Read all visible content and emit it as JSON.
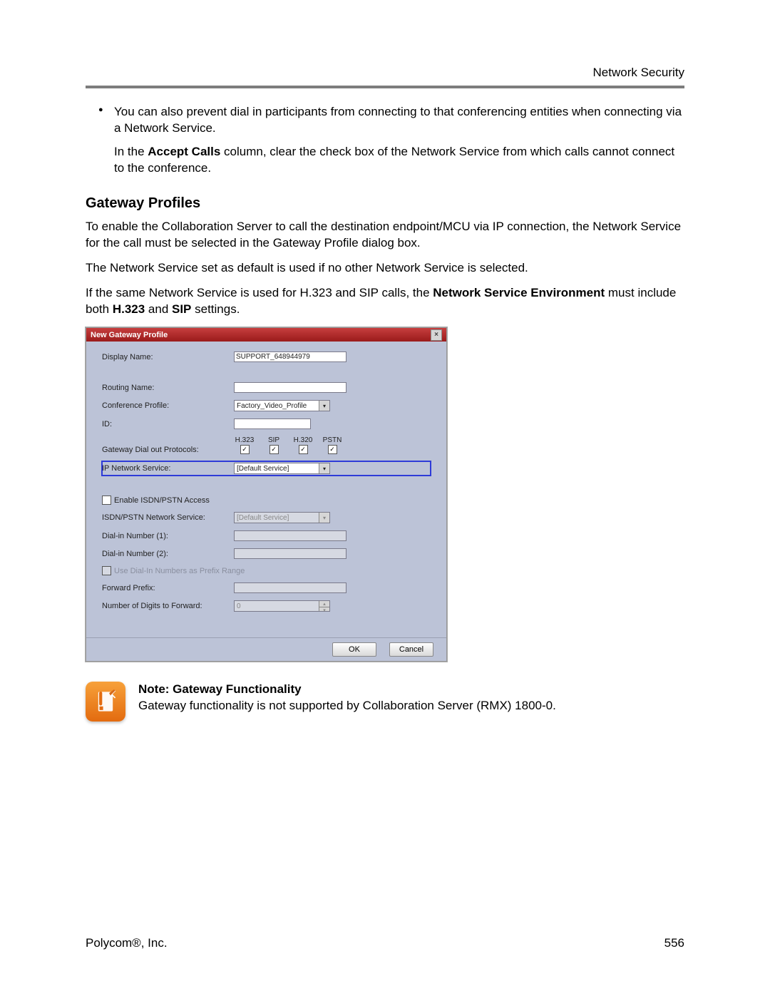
{
  "page_header_right": "Network Security",
  "bullets": {
    "li1": "You can also prevent dial in participants from connecting to that conferencing entities when connecting via a Network Service.",
    "li1b_prefix": "In the ",
    "li1b_bold": "Accept Calls",
    "li1b_suffix": " column, clear the check box of the Network Service from which calls cannot connect to the conference."
  },
  "heading_gateway": "Gateway Profiles",
  "p1": "To enable the Collaboration Server to call the destination endpoint/MCU via IP connection, the Network Service for the call must be selected in the Gateway Profile dialog box.",
  "p2": "The Network Service set as default is used if no other Network Service is selected.",
  "p3a": "If the same Network Service is used for H.323 and SIP calls, the ",
  "p3b_bold": "Network Service Environment",
  "p3c": " must include both ",
  "p3d_bold": "H.323",
  "p3e": " and ",
  "p3f_bold": "SIP",
  "p3g": " settings.",
  "dialog": {
    "title": "New Gateway Profile",
    "close": "×",
    "fields": {
      "display_name_lbl": "Display Name:",
      "display_name_val": "SUPPORT_648944979",
      "routing_name_lbl": "Routing Name:",
      "routing_name_val": "",
      "conf_profile_lbl": "Conference Profile:",
      "conf_profile_val": "Factory_Video_Profile",
      "id_lbl": "ID:",
      "id_val": "",
      "gw_proto_lbl": "Gateway Dial out Protocols:",
      "proto_cols": {
        "c1": "H.323",
        "c2": "SIP",
        "c3": "H.320",
        "c4": "PSTN"
      },
      "proto_check": "✓",
      "ip_ns_lbl": "IP Network Service:",
      "ip_ns_val": "[Default Service]",
      "enable_isdn_lbl": "Enable ISDN/PSTN Access",
      "isdn_ns_lbl": "ISDN/PSTN Network Service:",
      "isdn_ns_val": "[Default Service]",
      "dialin1_lbl": "Dial-in Number (1):",
      "dialin1_val": "",
      "dialin2_lbl": "Dial-in Number (2):",
      "dialin2_val": "",
      "use_prefix_lbl": "Use Dial-In Numbers as Prefix Range",
      "fwd_prefix_lbl": "Forward Prefix:",
      "fwd_prefix_val": "",
      "digits_fwd_lbl": "Number of Digits to Forward:",
      "digits_fwd_val": "0"
    },
    "ok": "OK",
    "cancel": "Cancel"
  },
  "note": {
    "title": "Note: Gateway Functionality",
    "body": "Gateway functionality is not supported by Collaboration Server (RMX) 1800-0."
  },
  "footer_left": "Polycom®, Inc.",
  "footer_right": "556"
}
